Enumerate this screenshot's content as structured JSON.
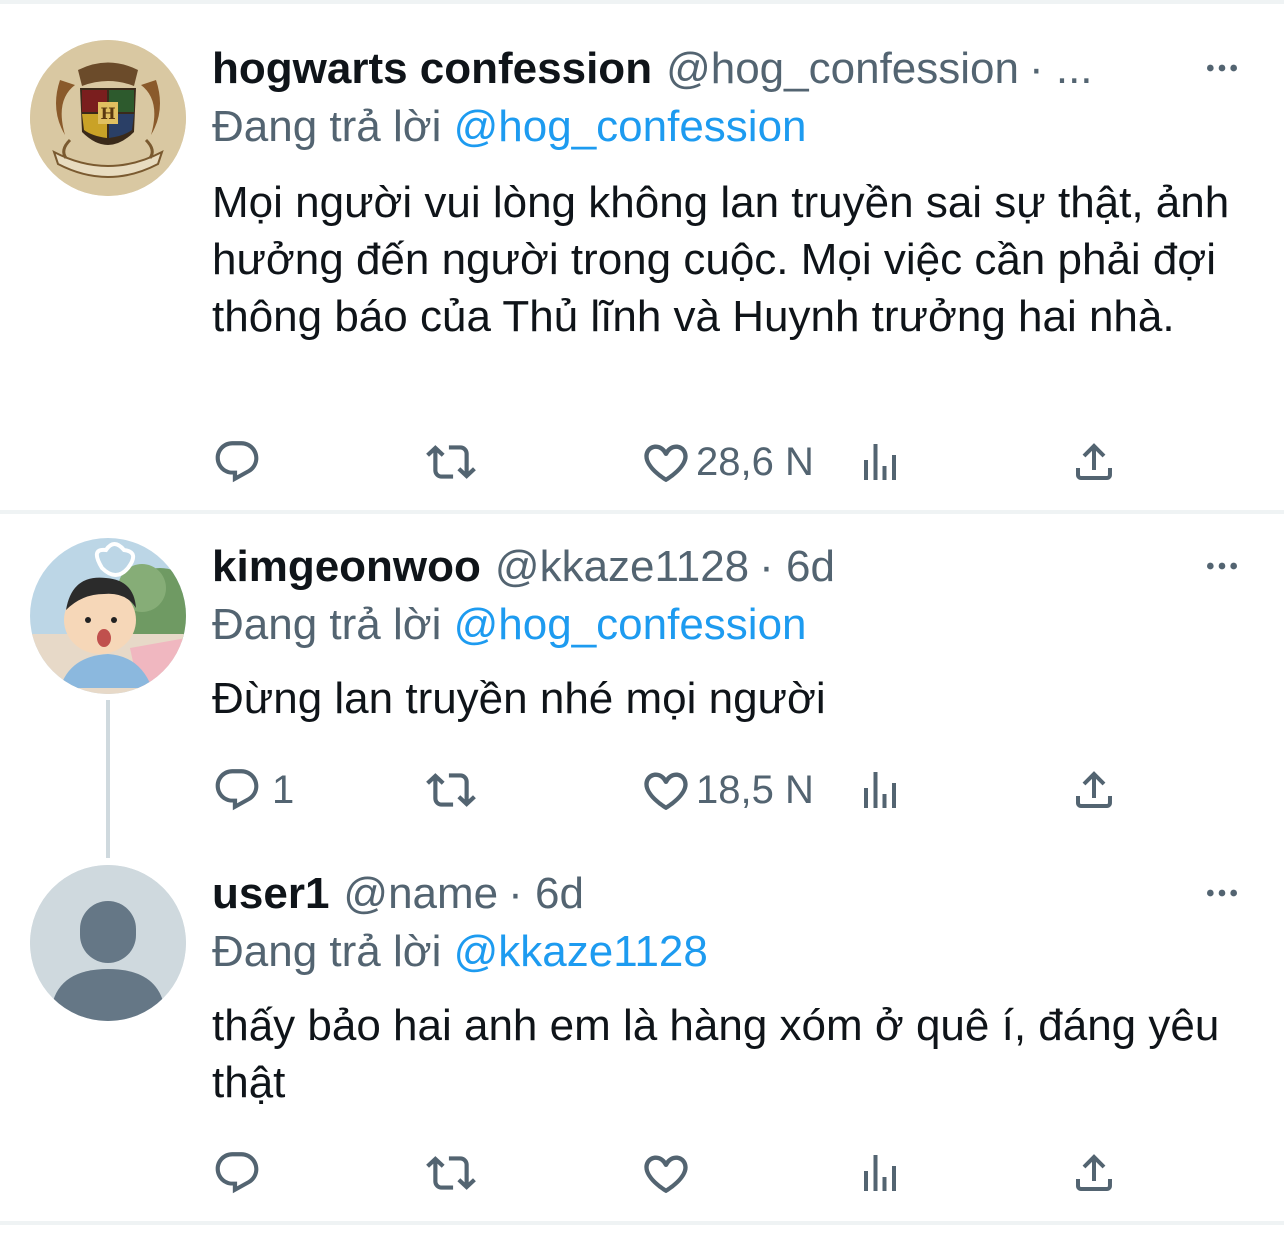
{
  "colors": {
    "text_primary": "#0f1419",
    "text_secondary": "#536471",
    "link": "#1d9bf0",
    "divider": "#eff3f4",
    "thread_line": "#cfd9de"
  },
  "tweets": [
    {
      "display_name": "hogwarts confession",
      "handle": "@hog_confession",
      "meta": "· ...",
      "reply_prefix": "Đang trả lời",
      "reply_mention": "@hog_confession",
      "text": "Mọi người vui lòng không lan truyền sai sự thật, ảnh hưởng đến người trong cuộc. Mọi việc cần phải đợi thông báo của Thủ lĩnh và Huynh trưởng hai nhà.",
      "avatar_icon": "hogwarts-crest-icon",
      "actions": {
        "reply_count": "",
        "retweet_count": "",
        "like_count": "28,6 N"
      }
    },
    {
      "display_name": "kimgeonwoo",
      "handle": "@kkaze1128",
      "meta": "· 6d",
      "reply_prefix": "Đang trả lời",
      "reply_mention": "@hog_confession",
      "text": "Đừng lan truyền nhé mọi người",
      "avatar_icon": "cartoon-avatar-icon",
      "actions": {
        "reply_count": "1",
        "retweet_count": "",
        "like_count": "18,5 N"
      }
    },
    {
      "display_name": "user1",
      "handle": "@name",
      "meta": "· 6d",
      "reply_prefix": "Đang trả lời",
      "reply_mention": "@kkaze1128",
      "text": "thấy bảo hai anh em là hàng xóm ở quê í, đáng yêu thật",
      "avatar_icon": "default-user-icon",
      "actions": {
        "reply_count": "",
        "retweet_count": "",
        "like_count": ""
      }
    }
  ]
}
